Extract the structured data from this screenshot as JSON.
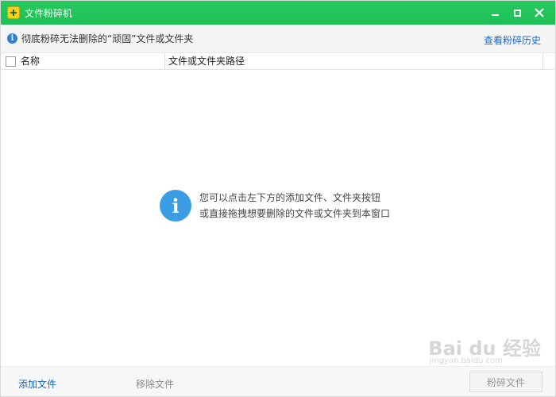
{
  "window": {
    "title": "文件粉碎机"
  },
  "infobar": {
    "text": "彻底粉碎无法删除的“顽固”文件或文件夹",
    "history_link": "查看粉碎历史"
  },
  "table": {
    "columns": [
      "名称",
      "文件或文件夹路径"
    ]
  },
  "empty_state": {
    "line1": "您可以点击左下方的添加文件、文件夹按钮",
    "line2": "或直接拖拽想要删除的文件或文件夹到本窗口"
  },
  "bottom": {
    "add_file": "添加文件",
    "remove_file": "移除文件",
    "shred_file": "粉碎文件"
  },
  "watermark": {
    "brand": "Bai du 经验",
    "url": "jingyan.baidu.com"
  },
  "colors": {
    "titlebar": "#22c55e",
    "link": "#1a66c9",
    "info_icon": "#3b9ee4"
  },
  "icons": [
    "app-logo-icon",
    "minimize-icon",
    "maximize-icon",
    "close-icon",
    "info-icon"
  ]
}
